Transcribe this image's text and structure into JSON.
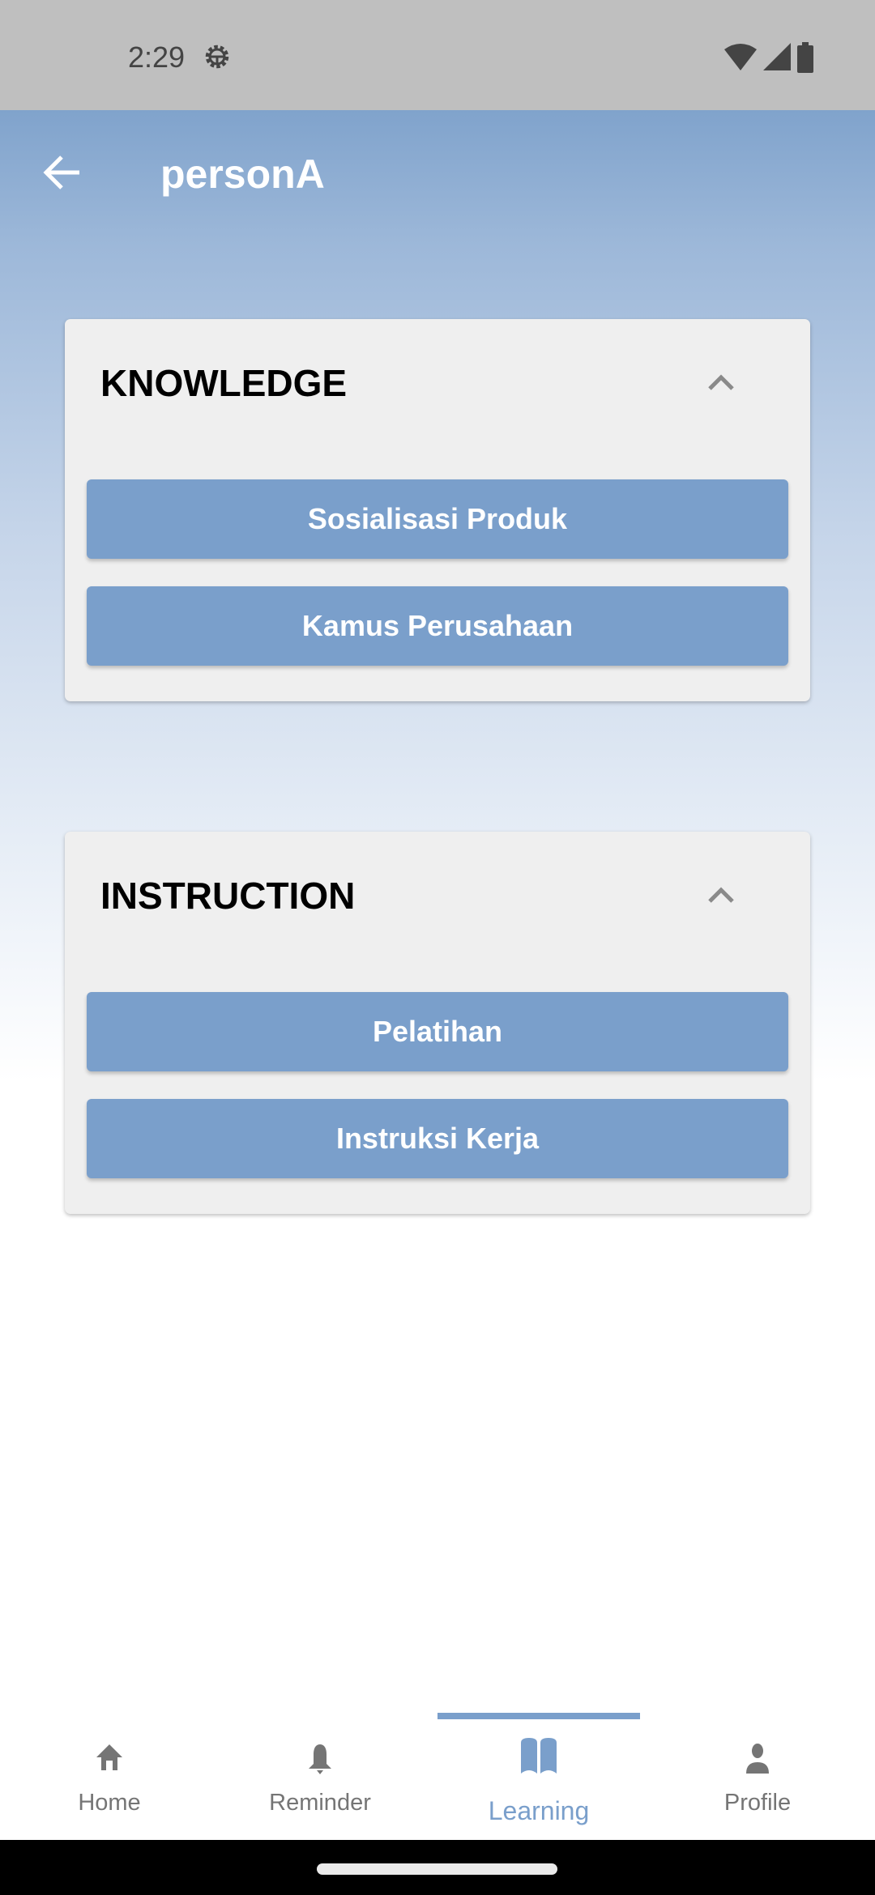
{
  "status_bar": {
    "time": "2:29",
    "icons": [
      "settings-gear-icon",
      "wifi-icon",
      "signal-icon",
      "battery-icon"
    ]
  },
  "header": {
    "title": "personA",
    "back_icon": "arrow-back-icon"
  },
  "sections": [
    {
      "title": "KNOWLEDGE",
      "expanded": true,
      "items": [
        {
          "label": "Sosialisasi Produk"
        },
        {
          "label": "Kamus Perusahaan"
        }
      ]
    },
    {
      "title": "INSTRUCTION",
      "expanded": true,
      "items": [
        {
          "label": "Pelatihan"
        },
        {
          "label": "Instruksi Kerja"
        }
      ]
    }
  ],
  "bottom_nav": {
    "active": "Learning",
    "items": [
      {
        "label": "Home",
        "icon": "home-icon"
      },
      {
        "label": "Reminder",
        "icon": "bell-icon"
      },
      {
        "label": "Learning",
        "icon": "book-icon"
      },
      {
        "label": "Profile",
        "icon": "person-icon"
      }
    ]
  },
  "colors": {
    "accent": "#7a9fcb",
    "status_bar": "#bfbfbf",
    "card": "#efefef",
    "inactive": "#757575"
  }
}
